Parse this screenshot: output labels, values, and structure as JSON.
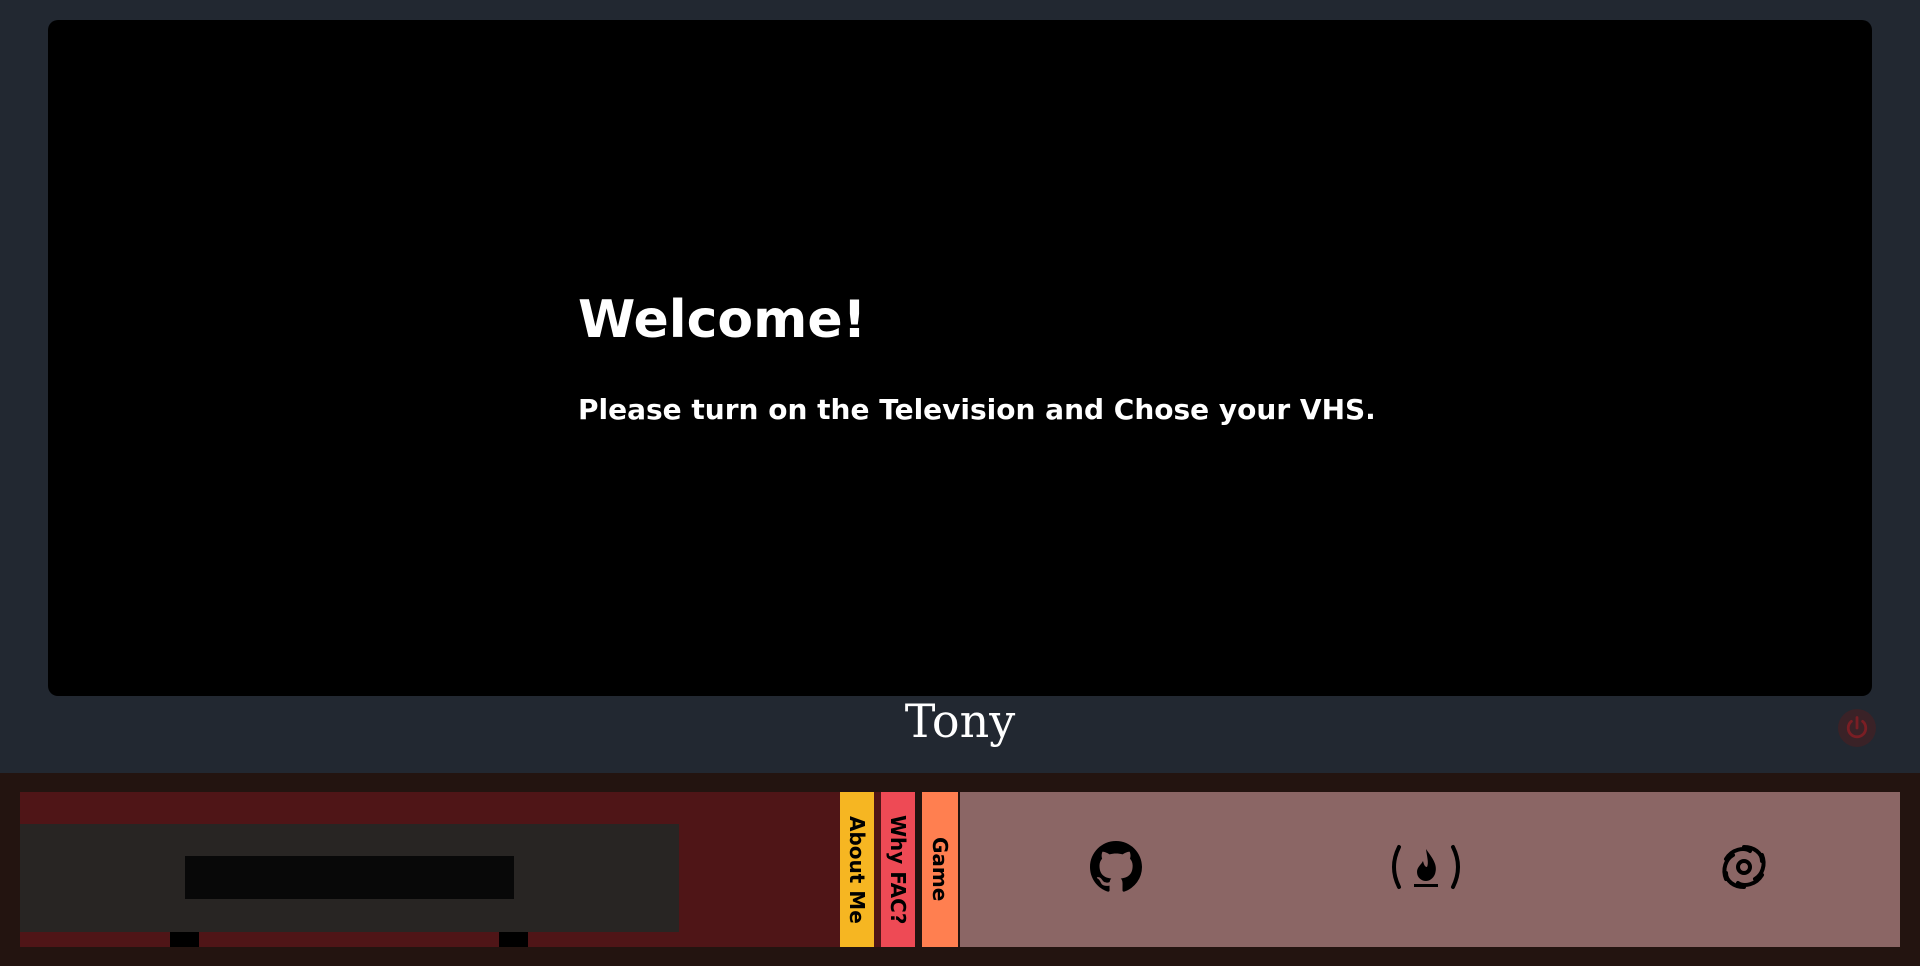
{
  "screen": {
    "title": "Welcome!",
    "message": "Please turn on the Television and Chose your VHS."
  },
  "tv": {
    "brand": "Tony",
    "power_icon": "power-icon"
  },
  "vhs_tapes": [
    {
      "label": "About Me",
      "color": "#f6b622"
    },
    {
      "label": "Why FAC?",
      "color": "#ee4a55"
    },
    {
      "label": "Game",
      "color": "#ff7f50"
    }
  ],
  "links": [
    {
      "icon": "github-icon"
    },
    {
      "icon": "freecodecamp-icon"
    },
    {
      "icon": "codewars-icon"
    }
  ],
  "colors": {
    "background": "#222831",
    "screen": "#000000",
    "shelf": "#231410",
    "shelf_back": "#4f1517",
    "links_panel": "#8b6665",
    "power": "#7a1e24"
  }
}
